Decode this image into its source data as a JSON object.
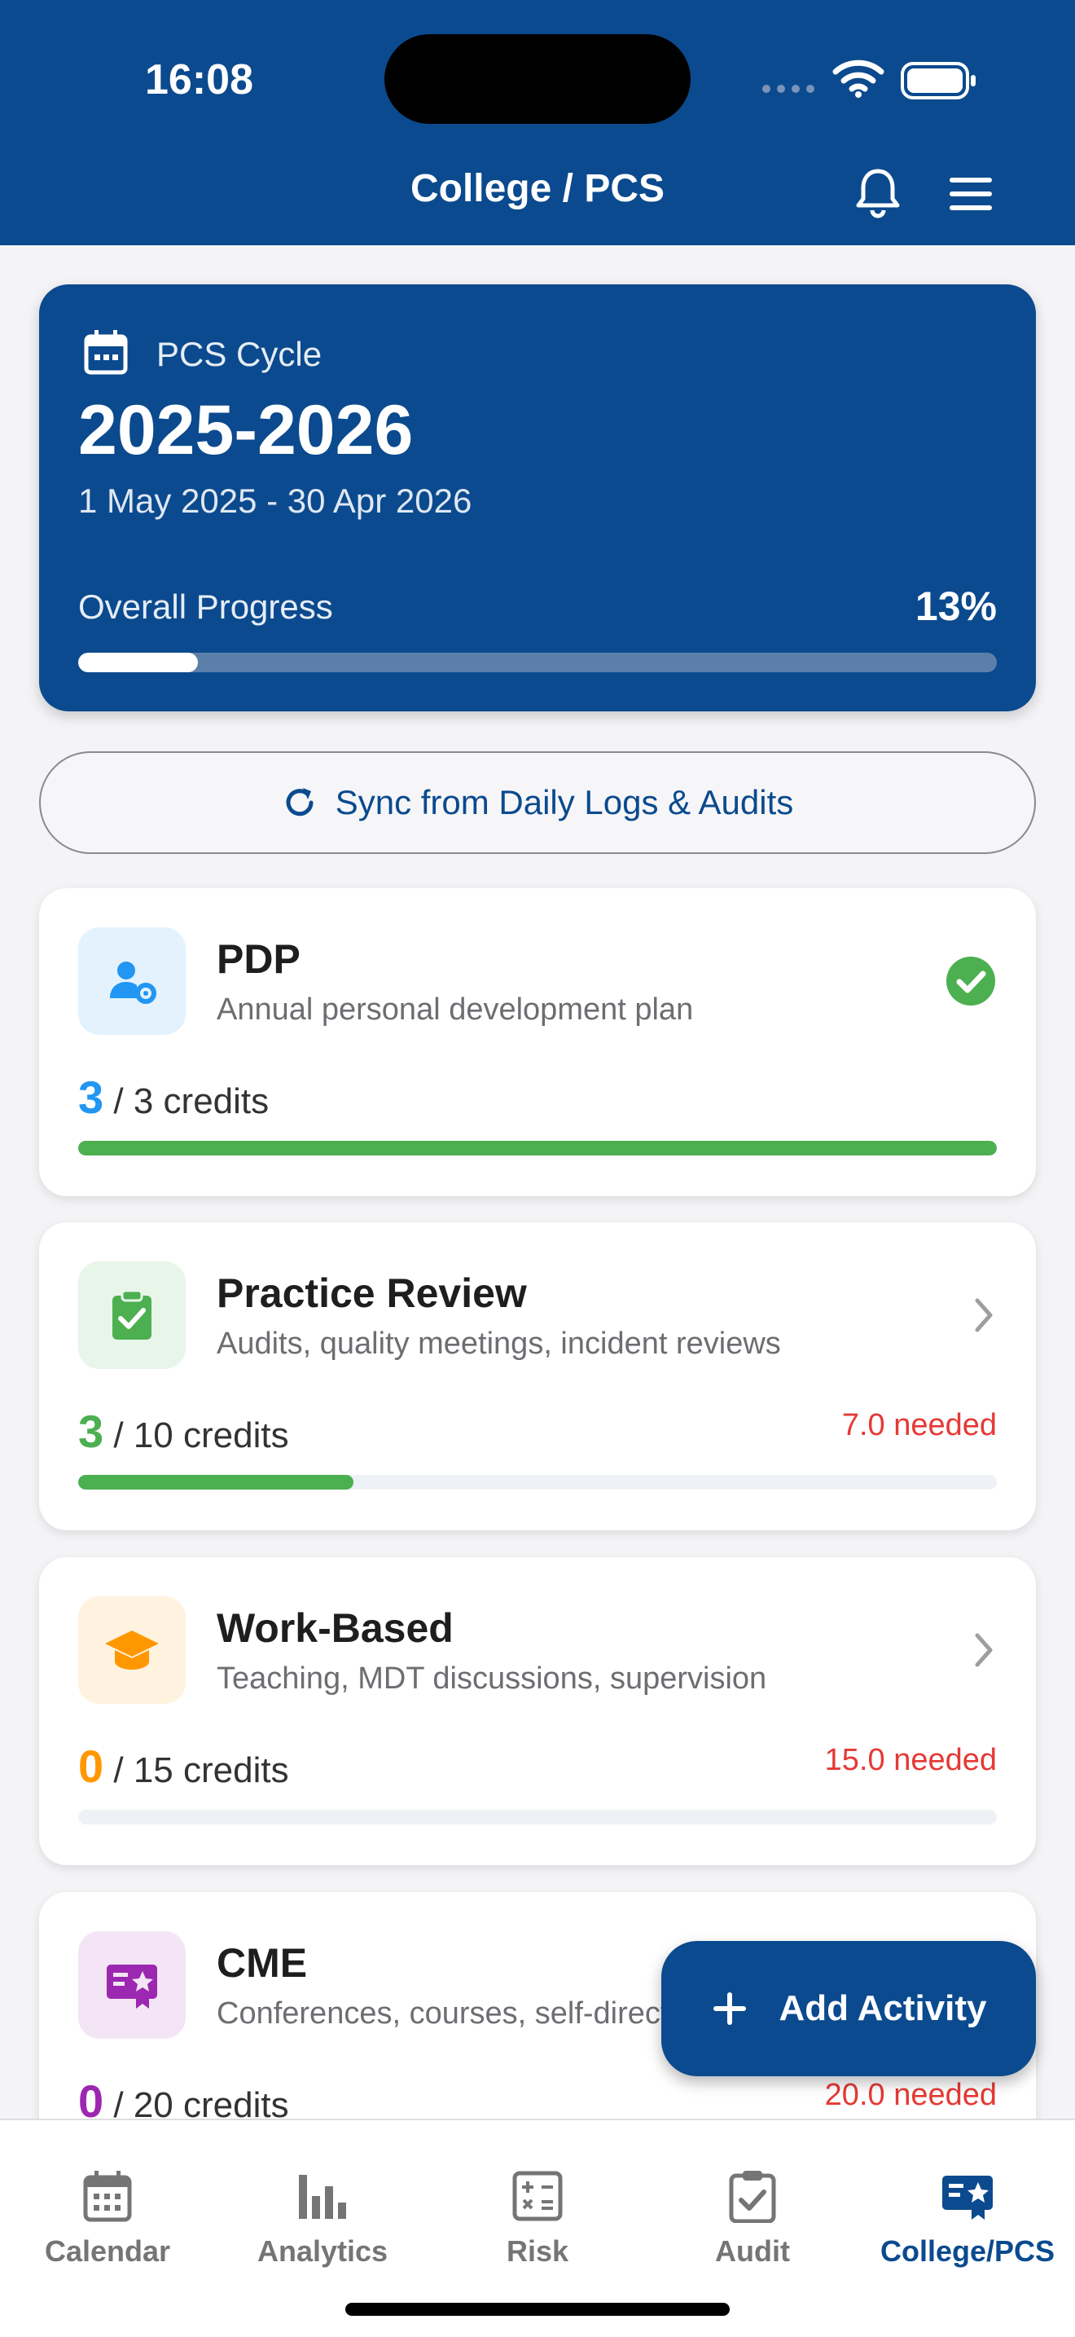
{
  "status_bar": {
    "time": "16:08"
  },
  "header": {
    "title": "College / PCS"
  },
  "cycle": {
    "label": "PCS Cycle",
    "year": "2025-2026",
    "dates": "1 May 2025 - 30 Apr 2026",
    "progress_label": "Overall Progress",
    "progress_text": "13%",
    "progress_value": 0.13
  },
  "sync_button": {
    "label": "Sync from Daily Logs & Audits"
  },
  "categories": [
    {
      "title": "PDP",
      "subtitle": "Annual personal development plan",
      "earned": "3",
      "credits_suffix": "/ 3 credits",
      "needed": "",
      "progress": 1.0,
      "accent": "#2196f3",
      "bar": "#4caf50",
      "status": "complete"
    },
    {
      "title": "Practice Review",
      "subtitle": "Audits, quality meetings, incident reviews",
      "earned": "3",
      "credits_suffix": "/ 10 credits",
      "needed": "7.0 needed",
      "progress": 0.3,
      "accent": "#4caf50",
      "bar": "#4caf50",
      "status": "open"
    },
    {
      "title": "Work-Based",
      "subtitle": "Teaching, MDT discussions, supervision",
      "earned": "0",
      "credits_suffix": "/ 15 credits",
      "needed": "15.0 needed",
      "progress": 0.0,
      "accent": "#ff9800",
      "bar": "#ff9800",
      "status": "open"
    },
    {
      "title": "CME",
      "subtitle": "Conferences, courses, self-directed learning",
      "earned": "0",
      "credits_suffix": "/ 20 credits",
      "needed": "20.0 needed",
      "progress": 0.0,
      "accent": "#9c27b0",
      "bar": "#9c27b0",
      "status": "open"
    }
  ],
  "fab": {
    "label": "Add Activity"
  },
  "tabs": [
    {
      "label": "Calendar",
      "icon": "calendar-icon"
    },
    {
      "label": "Analytics",
      "icon": "bar-chart-icon"
    },
    {
      "label": "Risk",
      "icon": "calculator-icon"
    },
    {
      "label": "Audit",
      "icon": "clipboard-check-icon"
    },
    {
      "label": "College/PCS",
      "icon": "certificate-icon",
      "active": true
    }
  ],
  "colors": {
    "primary": "#0b4a8e",
    "success": "#4caf50",
    "danger": "#e53935",
    "background": "#f4f4f6"
  }
}
